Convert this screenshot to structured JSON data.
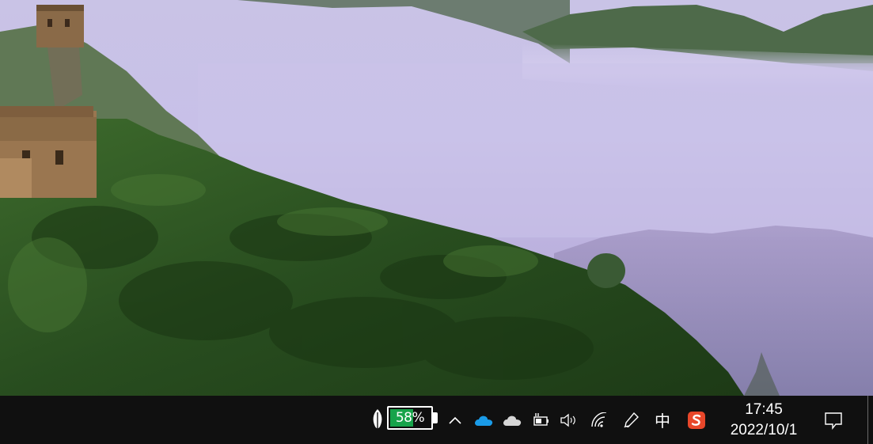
{
  "taskbar": {
    "battery": {
      "percent_label": "58%",
      "level": 0.58,
      "fill_color": "#17a34a"
    },
    "tray": {
      "power_mode_icon": "leaf-icon",
      "overflow_icon": "chevron-up-icon",
      "onedrive_icon": "cloud-icon",
      "onedrive_color": "#1a9be8",
      "weather_icon": "cloud-icon",
      "power_plug_icon": "plug-battery-icon",
      "volume_icon": "speaker-icon",
      "network_icon": "wifi-icon",
      "pen_icon": "pen-icon",
      "ime_label": "中",
      "sogou_icon": "sogou-s-icon",
      "sogou_color": "#e8472a"
    },
    "clock": {
      "time": "17:45",
      "date": "2022/10/1"
    },
    "notification_icon": "action-center-icon"
  }
}
